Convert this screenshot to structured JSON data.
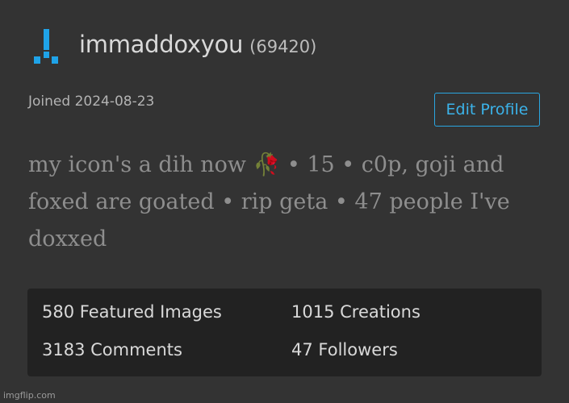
{
  "profile": {
    "username": "immaddoxyou",
    "points": "(69420)",
    "joined": "Joined 2024-08-23",
    "edit_profile_label": "Edit Profile",
    "bio": {
      "part1": "my icon's a dih now ",
      "emoji": "🥀",
      "part2": " • 15 • c0p, goji and foxed are goated • rip geta • 47 people I've doxxed"
    }
  },
  "stats": {
    "featured_images": "580 Featured Images",
    "creations": "1015 Creations",
    "comments": "3183 Comments",
    "followers": "47 Followers"
  },
  "watermark": "imgflip.com",
  "colors": {
    "background": "#333333",
    "accent": "#3bb3ea",
    "stats_background": "#222222",
    "avatar": "#1fa3e8"
  },
  "icons": {
    "avatar": "user-avatar-icon"
  }
}
